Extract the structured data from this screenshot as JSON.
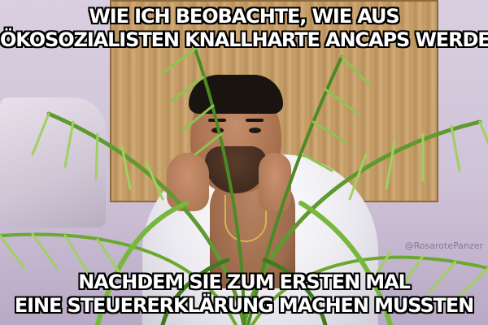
{
  "meme": {
    "top_text": [
      "WIE ICH BEOBACHTE, WIE AUS",
      "ÖKOSOZIALISTEN KNALLHARTE ANCAPS WERDEN"
    ],
    "bottom_text": [
      "NACHDEM SIE ZUM ERSTEN MAL",
      "EINE STEUERERKLÄRUNG MACHEN MUSSTEN"
    ],
    "watermark": "@RosarotePanzer"
  },
  "colors": {
    "caption_fill": "#ffffff",
    "caption_outline": "#000000",
    "foliage": "#5e9a2e",
    "foliage_light": "#9fd060",
    "wood_panel": "#c9a26c",
    "wall": "#d2c6dc"
  }
}
